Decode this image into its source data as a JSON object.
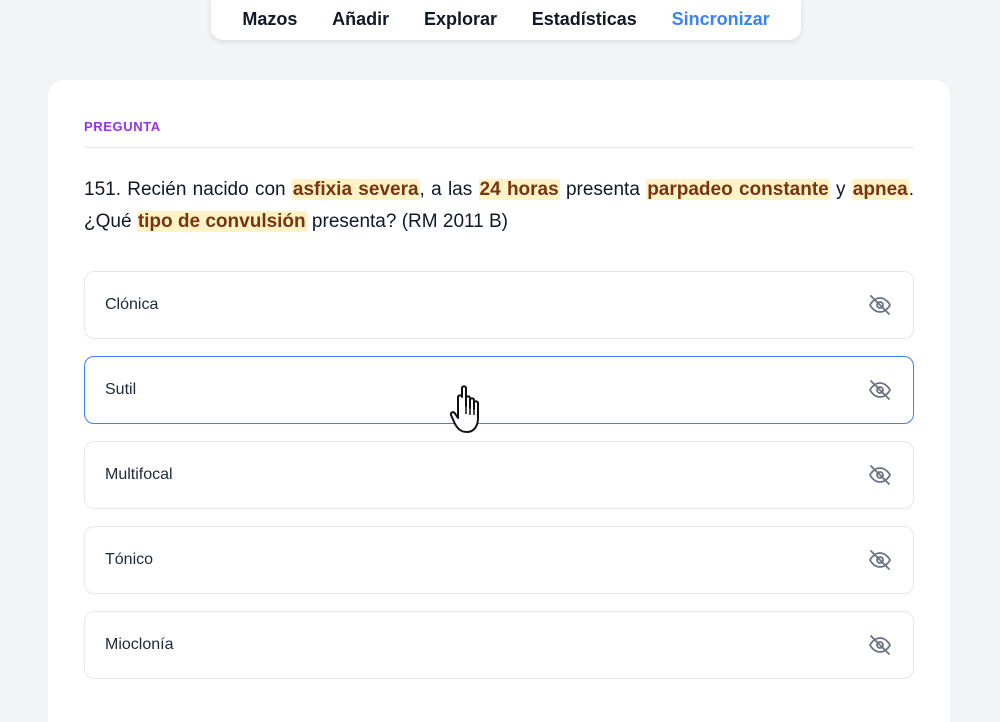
{
  "nav": {
    "items": [
      {
        "label": "Mazos",
        "active": false
      },
      {
        "label": "Añadir",
        "active": false
      },
      {
        "label": "Explorar",
        "active": false
      },
      {
        "label": "Estadísticas",
        "active": false
      },
      {
        "label": "Sincronizar",
        "active": true
      }
    ]
  },
  "card": {
    "section_label": "PREGUNTA",
    "question": {
      "parts": [
        {
          "text": "151. Recién nacido con ",
          "highlight": false
        },
        {
          "text": "asfixia severa",
          "highlight": true
        },
        {
          "text": ", a las ",
          "highlight": false
        },
        {
          "text": "24 horas",
          "highlight": true
        },
        {
          "text": " presenta ",
          "highlight": false
        },
        {
          "text": "parpadeo constante",
          "highlight": true
        },
        {
          "text": " y ",
          "highlight": false
        },
        {
          "text": "apnea",
          "highlight": true
        },
        {
          "text": ". ¿Qué ",
          "highlight": false
        },
        {
          "text": "tipo de convulsión",
          "highlight": true
        },
        {
          "text": " presenta? (RM 2011 B)",
          "highlight": false
        }
      ]
    },
    "options": [
      {
        "label": "Clónica",
        "icon": "eye-off-icon"
      },
      {
        "label": "Sutil",
        "icon": "eye-off-icon",
        "hover": true
      },
      {
        "label": "Multifocal",
        "icon": "eye-off-icon"
      },
      {
        "label": "Tónico",
        "icon": "eye-off-icon"
      },
      {
        "label": "Mioclonía",
        "icon": "eye-off-icon"
      }
    ]
  },
  "colors": {
    "accent": "#3b82f6",
    "section_label": "#9333ea",
    "highlight_bg": "#fef3c7",
    "highlight_text": "#78350f"
  }
}
